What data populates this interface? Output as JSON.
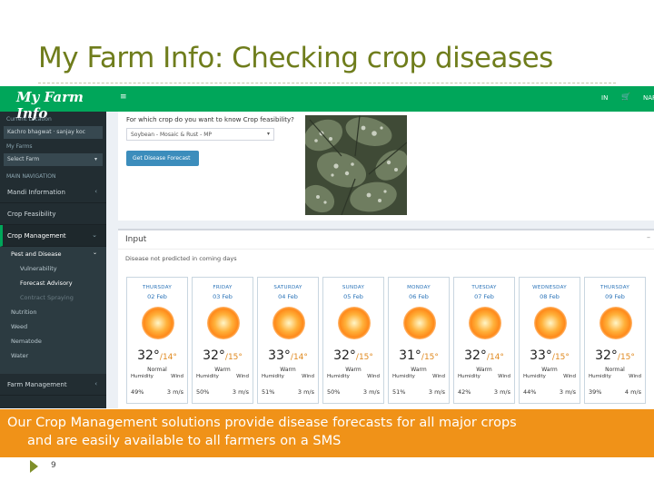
{
  "slide": {
    "title": "My Farm Info: Checking crop diseases",
    "caption_line1": "Our Crop Management solutions provide disease forecasts for all major crops",
    "caption_line2": "and are easily available to all farmers on a SMS",
    "page_number": "9"
  },
  "app": {
    "logo": "My Farm Info",
    "topbar": {
      "menu_icon": "≡",
      "lang": "IN",
      "user": "NAR"
    },
    "sidebar": {
      "location_label": "Current Location",
      "location_value": "Kachro bhagwat · sanjay koc",
      "farms_label": "My Farms",
      "farm_select": "Select Farm",
      "nav_label": "MAIN NAVIGATION",
      "items": [
        {
          "label": "Mandi Information"
        },
        {
          "label": "Crop Feasibility"
        },
        {
          "label": "Crop Management"
        }
      ],
      "sub_header": "Pest and Disease",
      "sub_items": [
        "Vulnerability",
        "Forecast Advisory",
        "Contract Spraying"
      ],
      "other_sub": [
        "Nutrition",
        "Weed",
        "Nematode",
        "Water"
      ],
      "farm_management": "Farm Management"
    },
    "panel1": {
      "question": "For which crop do you want to know Crop feasibility?",
      "select_value": "Soybean - Mosaic & Rust - MP",
      "button_label": "Get Disease Forecast"
    },
    "panel2": {
      "heading": "Input",
      "note": "Disease not predicted in coming days"
    },
    "weather": {
      "humidity_label": "Humidity",
      "wind_label": "Wind",
      "days": [
        {
          "day": "THURSDAY",
          "date": "02 Feb",
          "hi": "32°",
          "lo": "/14°",
          "cond": "Normal",
          "humidity": "49%",
          "wind": "3 m/s"
        },
        {
          "day": "FRIDAY",
          "date": "03 Feb",
          "hi": "32°",
          "lo": "/15°",
          "cond": "Warm",
          "humidity": "50%",
          "wind": "3 m/s"
        },
        {
          "day": "SATURDAY",
          "date": "04 Feb",
          "hi": "33°",
          "lo": "/14°",
          "cond": "Warm",
          "humidity": "51%",
          "wind": "3 m/s"
        },
        {
          "day": "SUNDAY",
          "date": "05 Feb",
          "hi": "32°",
          "lo": "/15°",
          "cond": "Warm",
          "humidity": "50%",
          "wind": "3 m/s"
        },
        {
          "day": "MONDAY",
          "date": "06 Feb",
          "hi": "31°",
          "lo": "/15°",
          "cond": "Warm",
          "humidity": "51%",
          "wind": "3 m/s"
        },
        {
          "day": "TUESDAY",
          "date": "07 Feb",
          "hi": "32°",
          "lo": "/14°",
          "cond": "Warm",
          "humidity": "42%",
          "wind": "3 m/s"
        },
        {
          "day": "WEDNESDAY",
          "date": "08 Feb",
          "hi": "33°",
          "lo": "/15°",
          "cond": "Warm",
          "humidity": "44%",
          "wind": "3 m/s"
        },
        {
          "day": "THURSDAY",
          "date": "09 Feb",
          "hi": "32°",
          "lo": "/15°",
          "cond": "Normal",
          "humidity": "39%",
          "wind": "4 m/s"
        }
      ]
    }
  },
  "colors": {
    "title": "#6f7d1c",
    "brand_green": "#00a65a",
    "sidebar": "#222d32",
    "caption": "#f09218",
    "button": "#3c8dbc"
  }
}
